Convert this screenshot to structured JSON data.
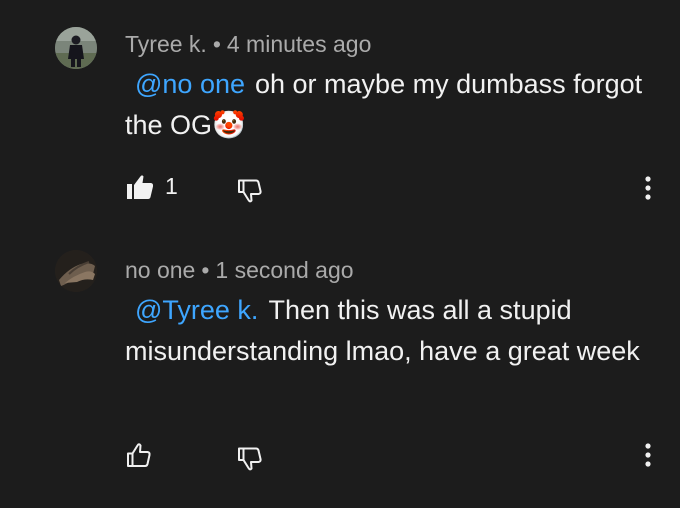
{
  "comments": [
    {
      "author": "Tyree k.",
      "separator": "•",
      "time": "4 minutes ago",
      "mention": "@no one",
      "text": "oh or maybe my dumbass forgot the OG",
      "emoji": "🤡",
      "like_count": "1",
      "liked": true
    },
    {
      "author": "no one",
      "separator": "•",
      "time": "1 second ago",
      "mention": "@Tyree k.",
      "text": "Then this was all a stupid misunderstanding lmao, have a great week",
      "like_count": "",
      "liked": false
    }
  ],
  "colors": {
    "background": "#1c1c1c",
    "mention": "#3ea6ff",
    "meta_text": "#aaaaaa",
    "body_text": "#f1f1f1"
  },
  "icons": {
    "like_filled": "thumbs-up-filled-icon",
    "like_outline": "thumbs-up-outline-icon",
    "dislike": "thumbs-down-outline-icon",
    "menu": "more-vert-icon"
  }
}
